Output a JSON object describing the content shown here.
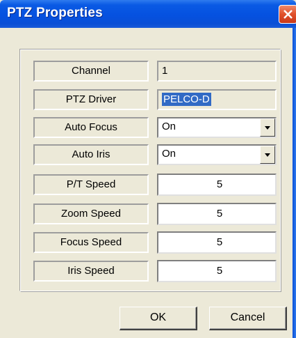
{
  "window": {
    "title": "PTZ Properties"
  },
  "fields": [
    {
      "label": "Channel",
      "value": "1",
      "type": "readonly"
    },
    {
      "label": "PTZ Driver",
      "value": "PELCO-D",
      "type": "readonly-selected"
    },
    {
      "label": "Auto Focus",
      "value": "On",
      "type": "combo"
    },
    {
      "label": "Auto Iris",
      "value": "On",
      "type": "combo"
    },
    {
      "label": "P/T Speed",
      "value": "5",
      "type": "number"
    },
    {
      "label": "Zoom Speed",
      "value": "5",
      "type": "number"
    },
    {
      "label": "Focus Speed",
      "value": "5",
      "type": "number"
    },
    {
      "label": "Iris Speed",
      "value": "5",
      "type": "number"
    }
  ],
  "buttons": {
    "ok": "OK",
    "cancel": "Cancel"
  },
  "icons": {
    "close": "close-icon",
    "dropdown": "chevron-down-icon"
  },
  "colors": {
    "titlebar": "#0551e0",
    "selection": "#316ac5",
    "dialog_bg": "#ece9d8",
    "close_button": "#e0502a"
  }
}
